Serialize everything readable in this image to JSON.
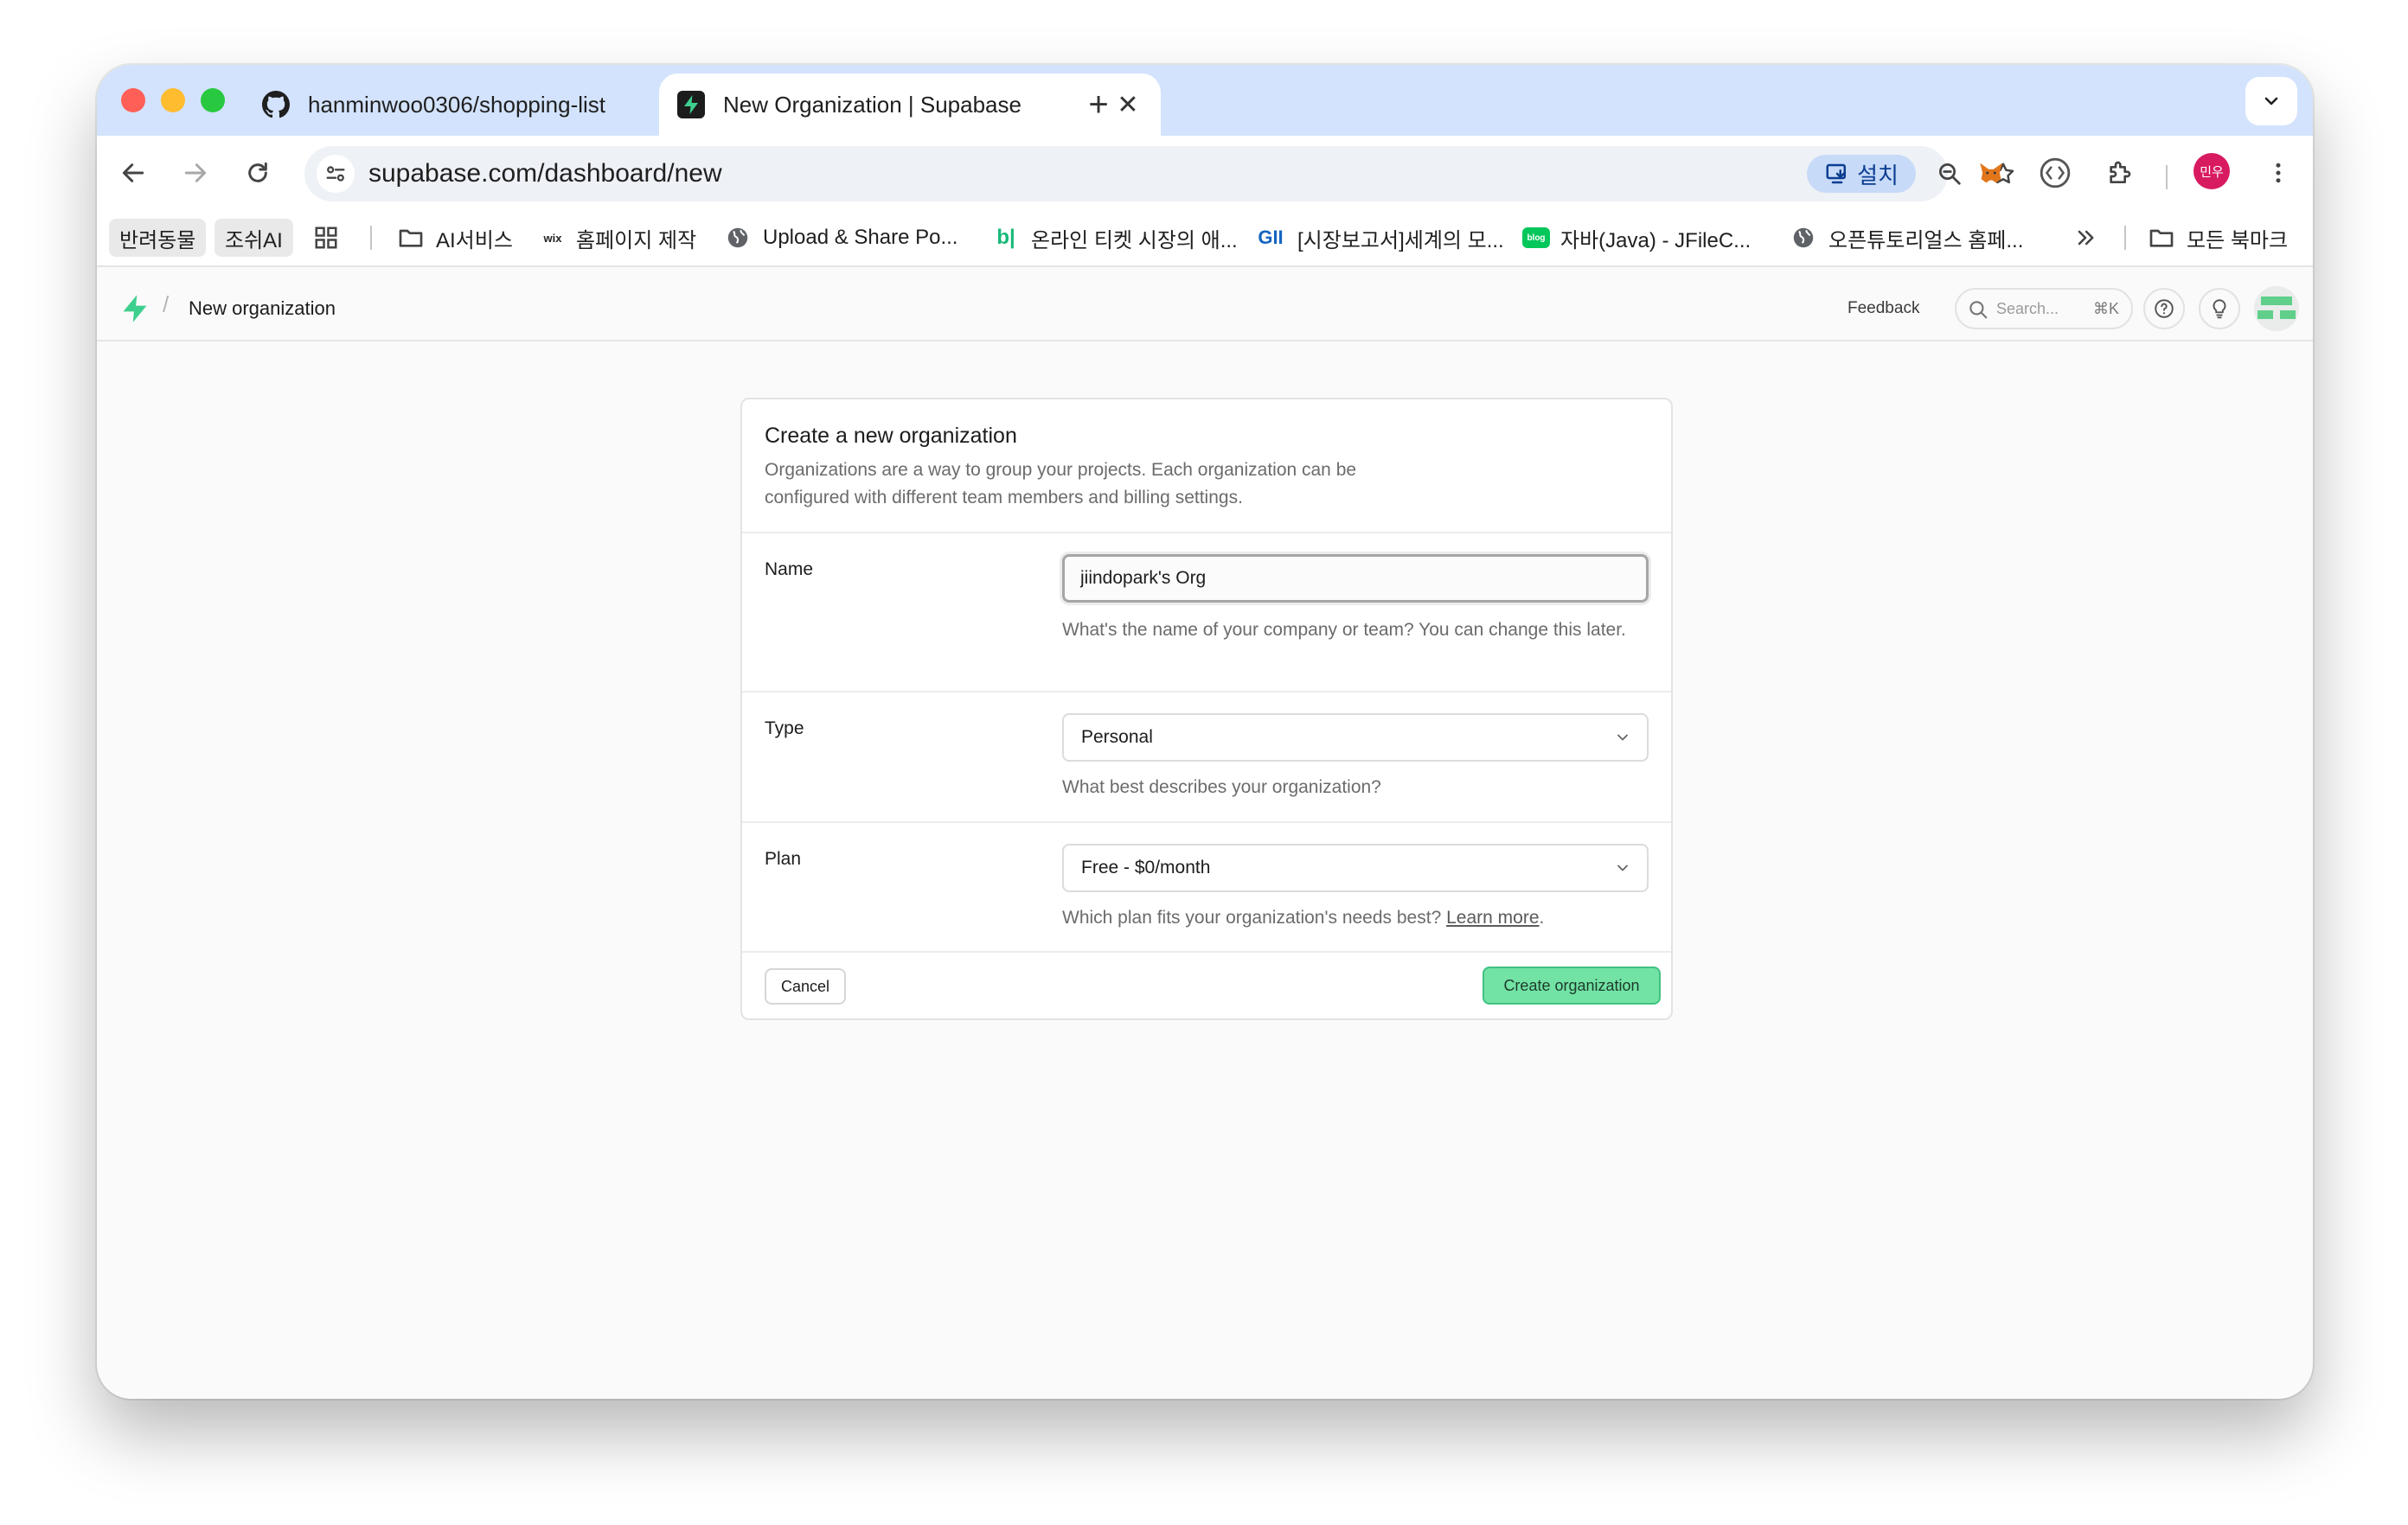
{
  "browser": {
    "tabs": [
      {
        "title": "hanminwoo0306/shopping-list",
        "favicon": "github-icon"
      },
      {
        "title": "New Organization | Supabase",
        "favicon": "supabase-icon",
        "active": true
      }
    ],
    "new_tab_glyph": "+",
    "close_glyph": "✕",
    "url": "supabase.com/dashboard/new",
    "install_label": "설치",
    "avatar_label": "민우"
  },
  "bookmarks": [
    {
      "label": "반려동물",
      "style": "chip"
    },
    {
      "label": "조쉬AI",
      "style": "chip"
    },
    {
      "label": "AI서비스",
      "icon": "folder-icon"
    },
    {
      "label": "홈페이지 제작",
      "icon": "wix-icon",
      "icon_text": "wix"
    },
    {
      "label": "Upload & Share Po...",
      "icon": "globe-icon"
    },
    {
      "label": "온라인 티켓 시장의 애...",
      "icon": "bi-icon",
      "icon_text": "b|"
    },
    {
      "label": "[시장보고서]세계의 모...",
      "icon": "gii-icon",
      "icon_text": "GII"
    },
    {
      "label": "자바(Java) - JFileC...",
      "icon": "blog-icon",
      "icon_text": "blog"
    },
    {
      "label": "오픈튜토리얼스 홈페...",
      "icon": "globe-icon"
    },
    {
      "label": "모든 북마크",
      "icon": "folder-icon"
    }
  ],
  "app_header": {
    "breadcrumb_sep": "/",
    "breadcrumb": "New organization",
    "feedback": "Feedback",
    "search_placeholder": "Search...",
    "search_shortcut": "⌘K"
  },
  "card": {
    "title": "Create a new organization",
    "description": "Organizations are a way to group your projects. Each organization can be configured with different team members and billing settings.",
    "fields": {
      "name": {
        "label": "Name",
        "value": "jiindopark's Org",
        "hint": "What's the name of your company or team? You can change this later."
      },
      "type": {
        "label": "Type",
        "value": "Personal",
        "hint": "What best describes your organization?"
      },
      "plan": {
        "label": "Plan",
        "value": "Free - $0/month",
        "hint": "Which plan fits your organization's needs best?",
        "hint_link": "Learn more",
        "hint_end": "."
      }
    },
    "cancel_label": "Cancel",
    "create_label": "Create organization"
  },
  "colors": {
    "accent_green": "#3ecf8e",
    "tabstrip": "#d3e3fd"
  }
}
